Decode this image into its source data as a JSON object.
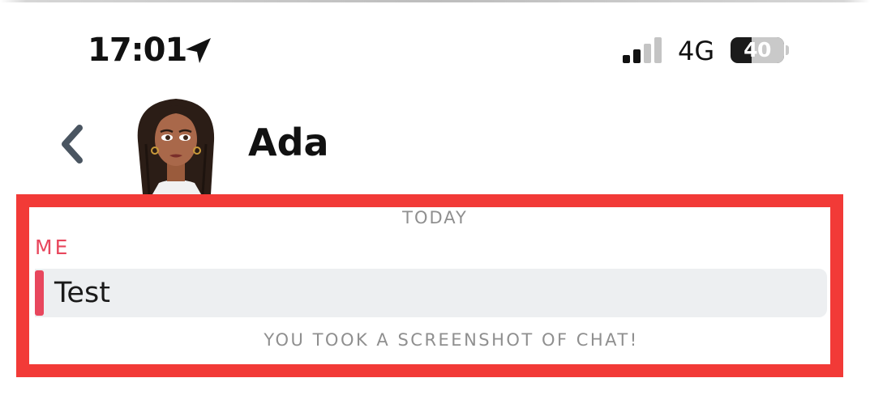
{
  "status_bar": {
    "time": "17:01",
    "location_icon": "location-arrow-icon",
    "signal_icon": "cellular-signal-icon",
    "signal_strength_bars": 2,
    "signal_total_bars": 4,
    "network": "4G",
    "battery_percent": "40",
    "battery_level": 0.4
  },
  "header": {
    "back_icon": "chevron-left-icon",
    "avatar": "bitmoji-avatar",
    "contact_name": "Ada"
  },
  "chat": {
    "day_separator": "TODAY",
    "messages": [
      {
        "sender": "ME",
        "text": "Test",
        "accent_color": "#e8475d"
      }
    ],
    "event_note": "YOU TOOK A SCREENSHOT OF CHAT!"
  },
  "colors": {
    "highlight_border": "#f23a37",
    "my_accent": "#e8475d",
    "message_bg": "#edeff1",
    "muted_text": "#8f8f8f"
  }
}
